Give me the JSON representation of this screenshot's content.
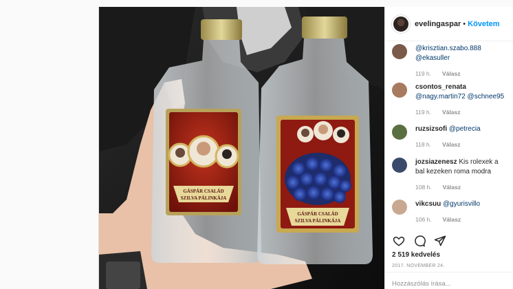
{
  "post": {
    "username": "evelingaspar",
    "dot": "•",
    "follow_label": "Követem",
    "likes": "2 519 kedvelés",
    "date": "2017. NOVEMBER 24.",
    "comment_placeholder": "Hozzászólás írása..."
  },
  "photo": {
    "label_text_left": "GÁSPÁR CSALÁD SZILVA PÁLINKÁJA",
    "label_text_right": "GÁSPÁR CSALÁD SZILVA PÁLINKÁJA"
  },
  "comments": [
    {
      "user": "",
      "text": "@krisztian.szabo.888 @ekasuller",
      "time": "119 h.",
      "reply": "Válasz",
      "avatar_color": "#7a5a4a"
    },
    {
      "user": "csontos_renata",
      "text": "@nagy.martin72 @schnee95",
      "time": "119 h.",
      "reply": "Válasz",
      "avatar_color": "#a87a60"
    },
    {
      "user": "ruzsizsofi",
      "text": "@petrecia",
      "time": "118 h.",
      "reply": "Válasz",
      "avatar_color": "#5a7040"
    },
    {
      "user": "jozsiazenesz",
      "text": "Kis rolexek a bal kezeken roma modra",
      "time": "108 h.",
      "reply": "Válasz",
      "avatar_color": "#3a4a6a"
    },
    {
      "user": "vikcsuu",
      "text": "@gyurisvillo",
      "time": "106 h.",
      "reply": "Válasz",
      "avatar_color": "#c8a890"
    }
  ],
  "icons": {
    "like": "heart-icon",
    "comment": "comment-bubble-icon",
    "share": "paper-plane-icon"
  },
  "colors": {
    "link": "#00376b",
    "follow": "#0095f6",
    "meta": "#8e8e8e"
  }
}
